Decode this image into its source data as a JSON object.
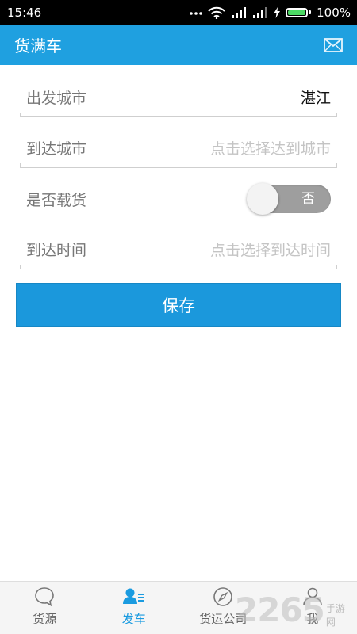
{
  "status_bar": {
    "time": "15:46",
    "battery": "100%",
    "battery_level": 1.0,
    "icons": [
      "more-dots-icon",
      "wifi-icon",
      "signal-icon",
      "signal-icon",
      "charging-icon",
      "battery-icon"
    ]
  },
  "app_bar": {
    "title": "货满车",
    "right_icon": "mail-icon"
  },
  "form": {
    "departure": {
      "label": "出发城市",
      "value": "湛江"
    },
    "arrival": {
      "label": "到达城市",
      "placeholder": "点击选择达到城市"
    },
    "loaded": {
      "label": "是否载货",
      "toggle_text": "否",
      "on": false
    },
    "arrival_time": {
      "label": "到达时间",
      "placeholder": "点击选择到达时间"
    }
  },
  "save_button": "保存",
  "bottom_nav": [
    {
      "label": "货源",
      "icon": "chat-bubble-icon",
      "active": false
    },
    {
      "label": "发车",
      "icon": "user-list-icon",
      "active": true
    },
    {
      "label": "货运公司",
      "icon": "compass-icon",
      "active": false
    },
    {
      "label": "我",
      "icon": "person-icon",
      "active": false
    }
  ],
  "watermark": {
    "number": "2265",
    "text": "手游网"
  },
  "colors": {
    "primary": "#1fa0e0",
    "button": "#1b98dc",
    "active_nav": "#1a9be0",
    "battery_fill": "#4cd964"
  }
}
